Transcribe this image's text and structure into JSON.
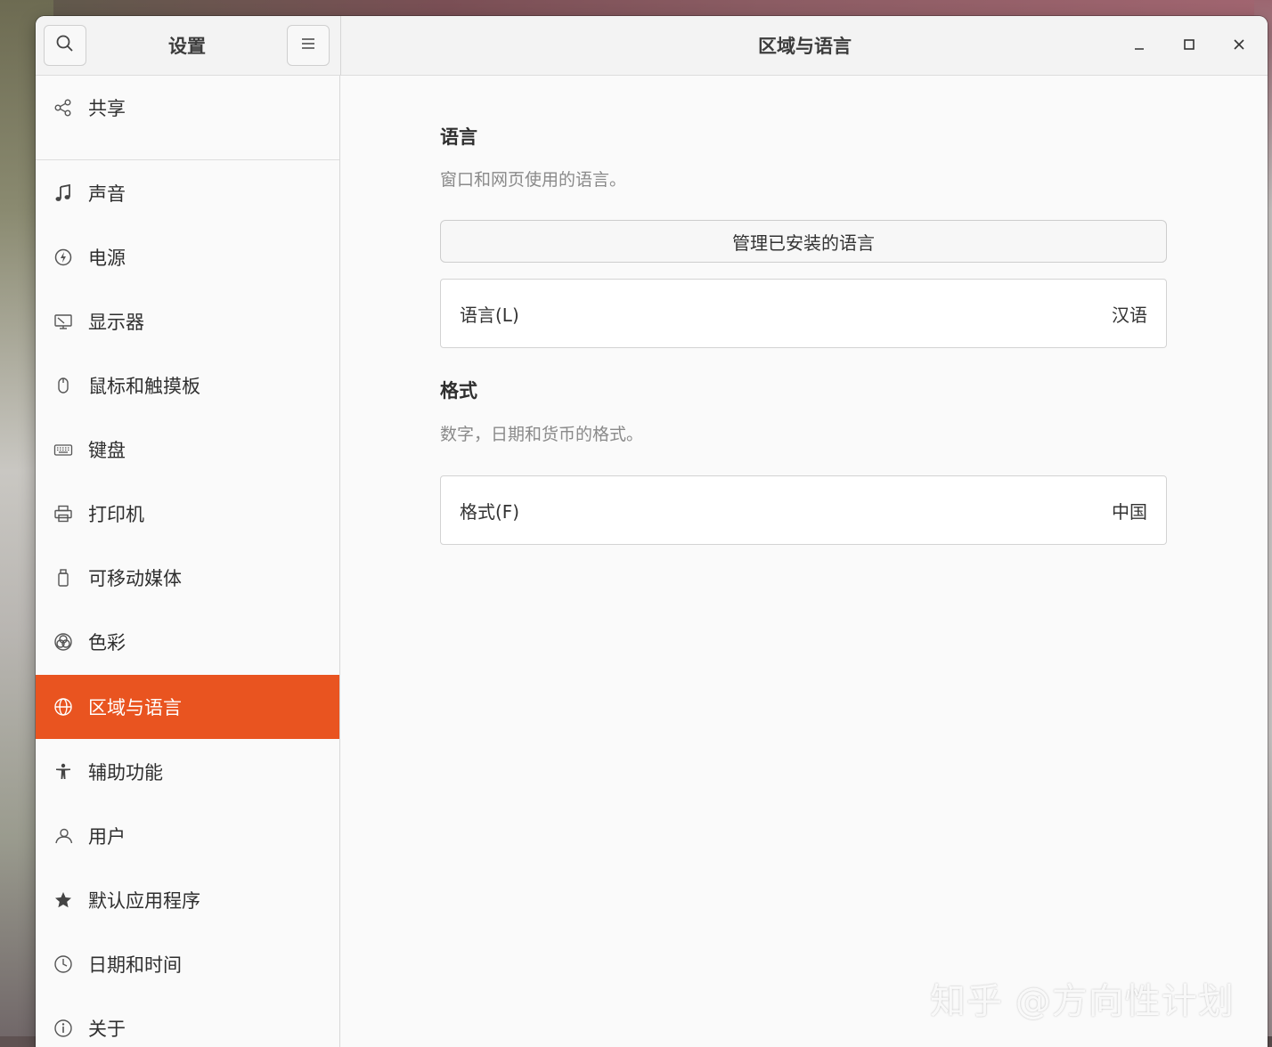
{
  "sidebar": {
    "title": "设置",
    "items": [
      {
        "label": "共享",
        "icon": "share-icon"
      },
      {
        "label": "声音",
        "icon": "music-note-icon"
      },
      {
        "label": "电源",
        "icon": "power-icon"
      },
      {
        "label": "显示器",
        "icon": "display-icon"
      },
      {
        "label": "鼠标和触摸板",
        "icon": "mouse-icon"
      },
      {
        "label": "键盘",
        "icon": "keyboard-icon"
      },
      {
        "label": "打印机",
        "icon": "printer-icon"
      },
      {
        "label": "可移动媒体",
        "icon": "removable-media-icon"
      },
      {
        "label": "色彩",
        "icon": "color-icon"
      },
      {
        "label": "区域与语言",
        "icon": "globe-icon",
        "active": true
      },
      {
        "label": "辅助功能",
        "icon": "accessibility-icon"
      },
      {
        "label": "用户",
        "icon": "user-icon"
      },
      {
        "label": "默认应用程序",
        "icon": "star-icon"
      },
      {
        "label": "日期和时间",
        "icon": "clock-icon"
      },
      {
        "label": "关于",
        "icon": "info-icon"
      }
    ]
  },
  "header": {
    "title": "区域与语言"
  },
  "main": {
    "language_section": {
      "title": "语言",
      "description": "窗口和网页使用的语言。",
      "manage_button": "管理已安装的语言",
      "row_label": "语言(L)",
      "row_value": "汉语"
    },
    "format_section": {
      "title": "格式",
      "description": "数字，日期和货币的格式。",
      "row_label": "格式(F)",
      "row_value": "中国"
    }
  },
  "watermark": "知乎 @方向性计划",
  "colors": {
    "accent": "#e95420",
    "window_bg": "#fafafa",
    "header_bg": "#f3f3f3"
  }
}
